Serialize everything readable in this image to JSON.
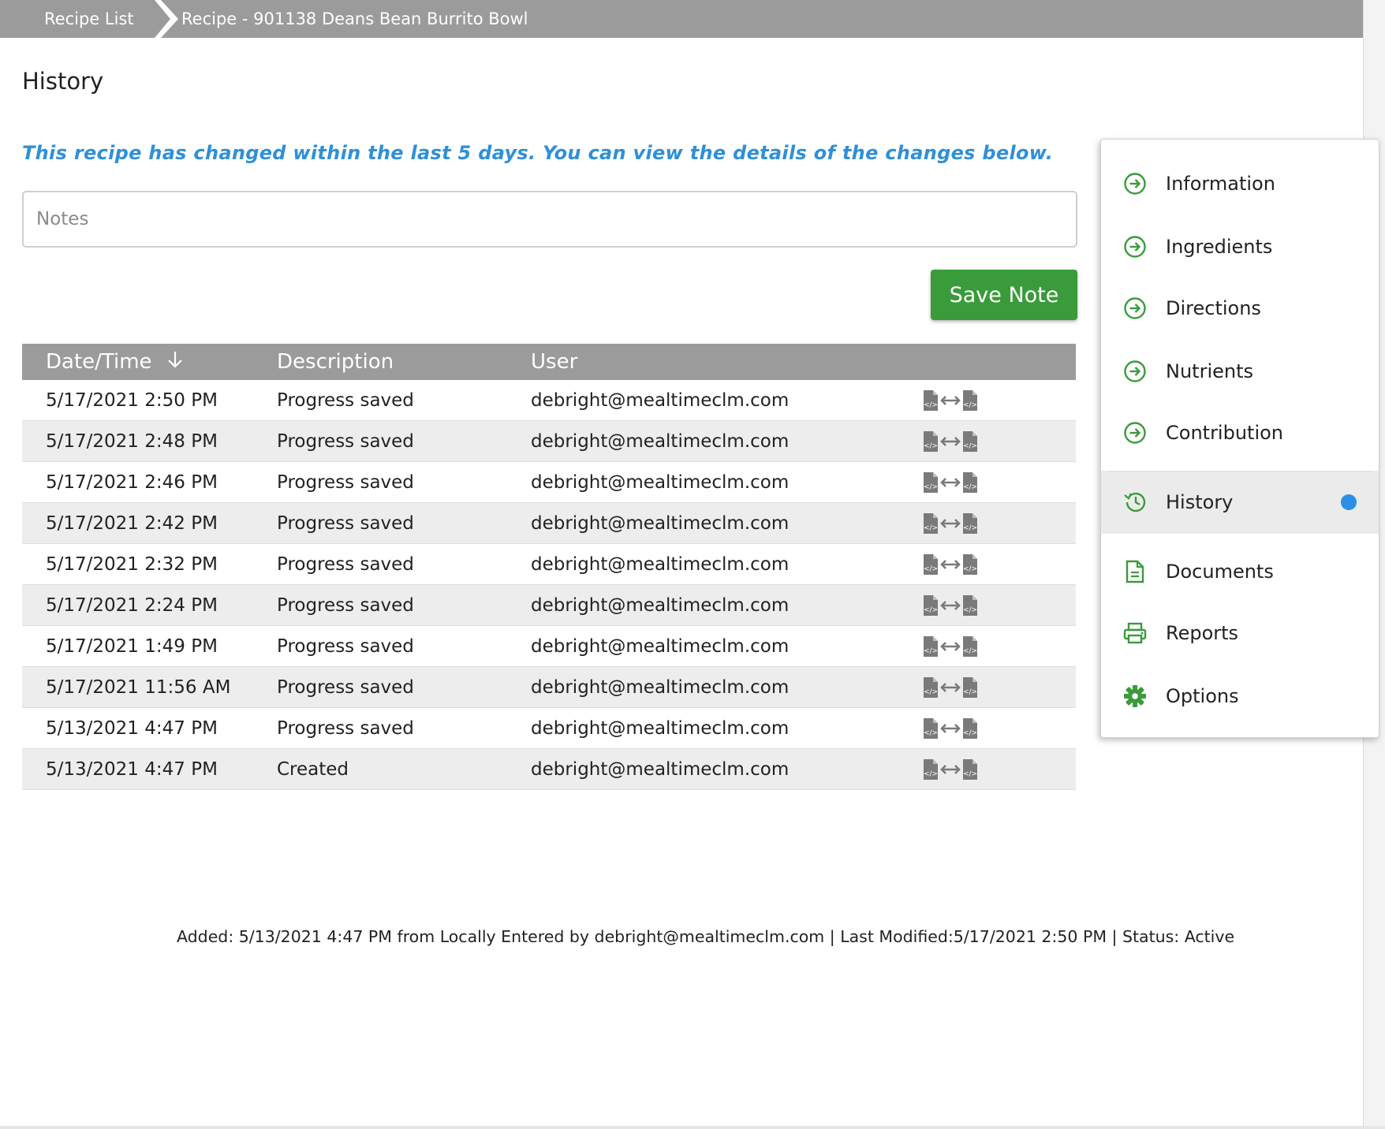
{
  "breadcrumb": {
    "items": [
      "Recipe List",
      "Recipe - 901138 Deans Bean Burrito Bowl"
    ]
  },
  "page": {
    "title": "History",
    "change_message": "This recipe has changed within the last 5 days. You can view the details of the changes below."
  },
  "notes": {
    "placeholder": "Notes",
    "value": ""
  },
  "save_note_label": "Save Note",
  "table": {
    "columns": [
      "Date/Time",
      "Description",
      "User"
    ],
    "rows": [
      {
        "datetime": "5/17/2021 2:50 PM",
        "description": "Progress saved",
        "user": "debright@mealtimeclm.com"
      },
      {
        "datetime": "5/17/2021 2:48 PM",
        "description": "Progress saved",
        "user": "debright@mealtimeclm.com"
      },
      {
        "datetime": "5/17/2021 2:46 PM",
        "description": "Progress saved",
        "user": "debright@mealtimeclm.com"
      },
      {
        "datetime": "5/17/2021 2:42 PM",
        "description": "Progress saved",
        "user": "debright@mealtimeclm.com"
      },
      {
        "datetime": "5/17/2021 2:32 PM",
        "description": "Progress saved",
        "user": "debright@mealtimeclm.com"
      },
      {
        "datetime": "5/17/2021 2:24 PM",
        "description": "Progress saved",
        "user": "debright@mealtimeclm.com"
      },
      {
        "datetime": "5/17/2021 1:49 PM",
        "description": "Progress saved",
        "user": "debright@mealtimeclm.com"
      },
      {
        "datetime": "5/17/2021 11:56 AM",
        "description": "Progress saved",
        "user": "debright@mealtimeclm.com"
      },
      {
        "datetime": "5/13/2021 4:47 PM",
        "description": "Progress saved",
        "user": "debright@mealtimeclm.com"
      },
      {
        "datetime": "5/13/2021 4:47 PM",
        "description": "Created",
        "user": "debright@mealtimeclm.com"
      }
    ]
  },
  "side_menu": {
    "items": [
      {
        "label": "Information",
        "icon": "arrow-circle-right-icon"
      },
      {
        "label": "Ingredients",
        "icon": "arrow-circle-right-icon"
      },
      {
        "label": "Directions",
        "icon": "arrow-circle-right-icon"
      },
      {
        "label": "Nutrients",
        "icon": "arrow-circle-right-icon"
      },
      {
        "label": "Contribution",
        "icon": "arrow-circle-right-icon"
      },
      {
        "label": "History",
        "icon": "history-icon",
        "active": true
      },
      {
        "label": "Documents",
        "icon": "document-icon"
      },
      {
        "label": "Reports",
        "icon": "printer-icon"
      },
      {
        "label": "Options",
        "icon": "gear-icon"
      }
    ]
  },
  "footer": {
    "text": "Added: 5/13/2021 4:47 PM from Locally Entered by debright@mealtimeclm.com | Last Modified:5/17/2021 2:50 PM | Status: Active"
  },
  "colors": {
    "accent_green": "#3a9b3a",
    "message_blue": "#2f90d7",
    "header_gray": "#9b9b9b",
    "active_dot_blue": "#2b8fe8"
  }
}
